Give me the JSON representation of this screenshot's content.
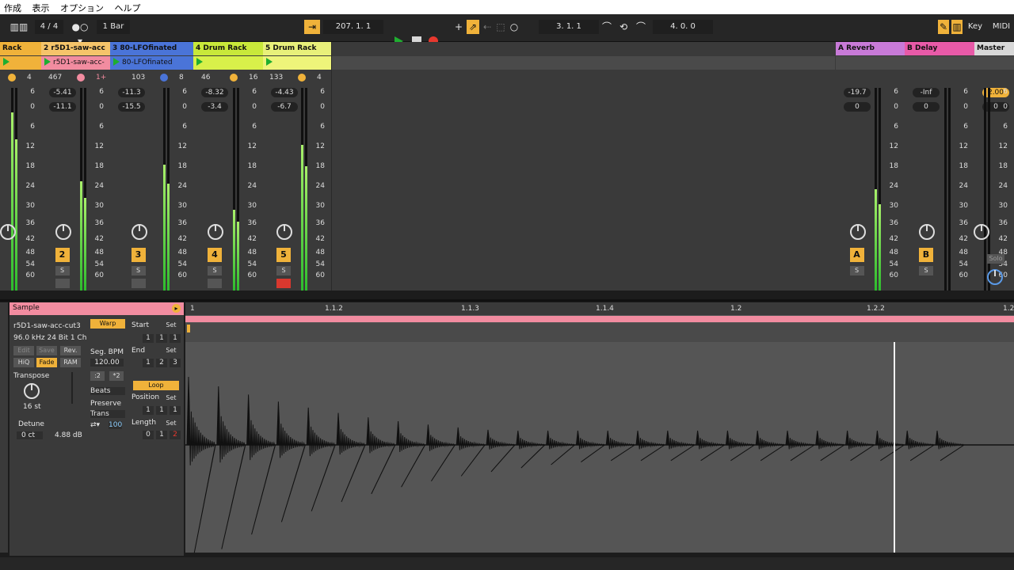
{
  "menu": [
    "作成",
    "表示",
    "オプション",
    "ヘルプ"
  ],
  "transport": {
    "time_sig": "4 / 4",
    "quantize": "1 Bar",
    "tempo": "207.  1.  1",
    "position": "3.  1.  1",
    "loop_length": "4.  0.  0",
    "key_label": "Key",
    "midi_label": "MIDI",
    "play_color": "#1fae30",
    "record_color": "#e8382e"
  },
  "tracks": [
    {
      "title": "Rack",
      "color": "#f0b23a",
      "clip": "",
      "clip_color": "#f0b23a",
      "stat1": "",
      "stat2": "4",
      "vol": "",
      "vol2": "",
      "num": ""
    },
    {
      "title": "2 r5D1-saw-acc",
      "color": "#f5c46a",
      "clip": "r5D1-saw-acc-",
      "clip_color": "#f28ca0",
      "stat1": "467",
      "stat2": "1+",
      "vol": "-5.41",
      "vol2": "-11.1",
      "num": "2"
    },
    {
      "title": "3 80-LFOfinated",
      "color": "#4a74d8",
      "clip": "80-LFOfinated",
      "clip_color": "#4a74d8",
      "stat1": "103",
      "stat2": "8",
      "vol": "-11.3",
      "vol2": "-15.5",
      "num": "3"
    },
    {
      "title": "4 Drum Rack",
      "color": "#c8e83a",
      "clip": "",
      "clip_color": "#d8f04a",
      "stat1": "46",
      "stat2": "16",
      "vol": "-8.32",
      "vol2": "-3.4",
      "num": "4"
    },
    {
      "title": "5 Drum Rack",
      "color": "#e8f07a",
      "clip": "",
      "clip_color": "#eef47a",
      "stat1": "133",
      "stat2": "4",
      "vol": "-4.43",
      "vol2": "-6.7",
      "num": "5"
    }
  ],
  "returns": [
    {
      "title": "A Reverb",
      "color": "#c87ad8",
      "vol": "-19.7",
      "vol2": "0",
      "num": "A"
    },
    {
      "title": "B Delay",
      "color": "#e85aa8",
      "vol": "-Inf",
      "vol2": "0",
      "num": "B"
    },
    {
      "title": "Master",
      "color": "#d8d8d8",
      "vol": "2.00",
      "vol2": "0",
      "num": ""
    }
  ],
  "scale_labels": [
    "6",
    "0",
    "6",
    "12",
    "18",
    "24",
    "30",
    "36",
    "42",
    "48",
    "54",
    "60"
  ],
  "s_label": "S",
  "solo_label": "Solo",
  "sample": {
    "header": "Sample",
    "name": "r5D1-saw-acc-cut3",
    "format": "96.0 kHz 24 Bit 1 Ch",
    "edit": "Edit",
    "save": "Save",
    "rev": "Rev.",
    "hiq": "HiQ",
    "fade": "Fade",
    "ram": "RAM",
    "transpose_label": "Transpose",
    "transpose_value": "16 st",
    "detune_label": "Detune",
    "detune_value": "0 ct",
    "gain_value": "4.88 dB",
    "warp": "Warp",
    "seg_bpm_label": "Seg. BPM",
    "seg_bpm_value": "120.00",
    "half": ":2",
    "double": "*2",
    "beats": "Beats",
    "preserve_label": "Preserve",
    "trans": "Trans",
    "envelope_value": "100",
    "start_label": "Start",
    "set_label": "Set",
    "start_value": [
      "1",
      "1",
      "1"
    ],
    "end_label": "End",
    "end_value": [
      "1",
      "2",
      "3"
    ],
    "loop": "Loop",
    "position_label": "Position",
    "position_value": [
      "1",
      "1",
      "1"
    ],
    "length_label": "Length",
    "length_value": [
      "0",
      "1",
      "2"
    ]
  },
  "ruler": [
    "1",
    "1.1.2",
    "1.1.3",
    "1.1.4",
    "1.2",
    "1.2.2",
    "1.2"
  ]
}
